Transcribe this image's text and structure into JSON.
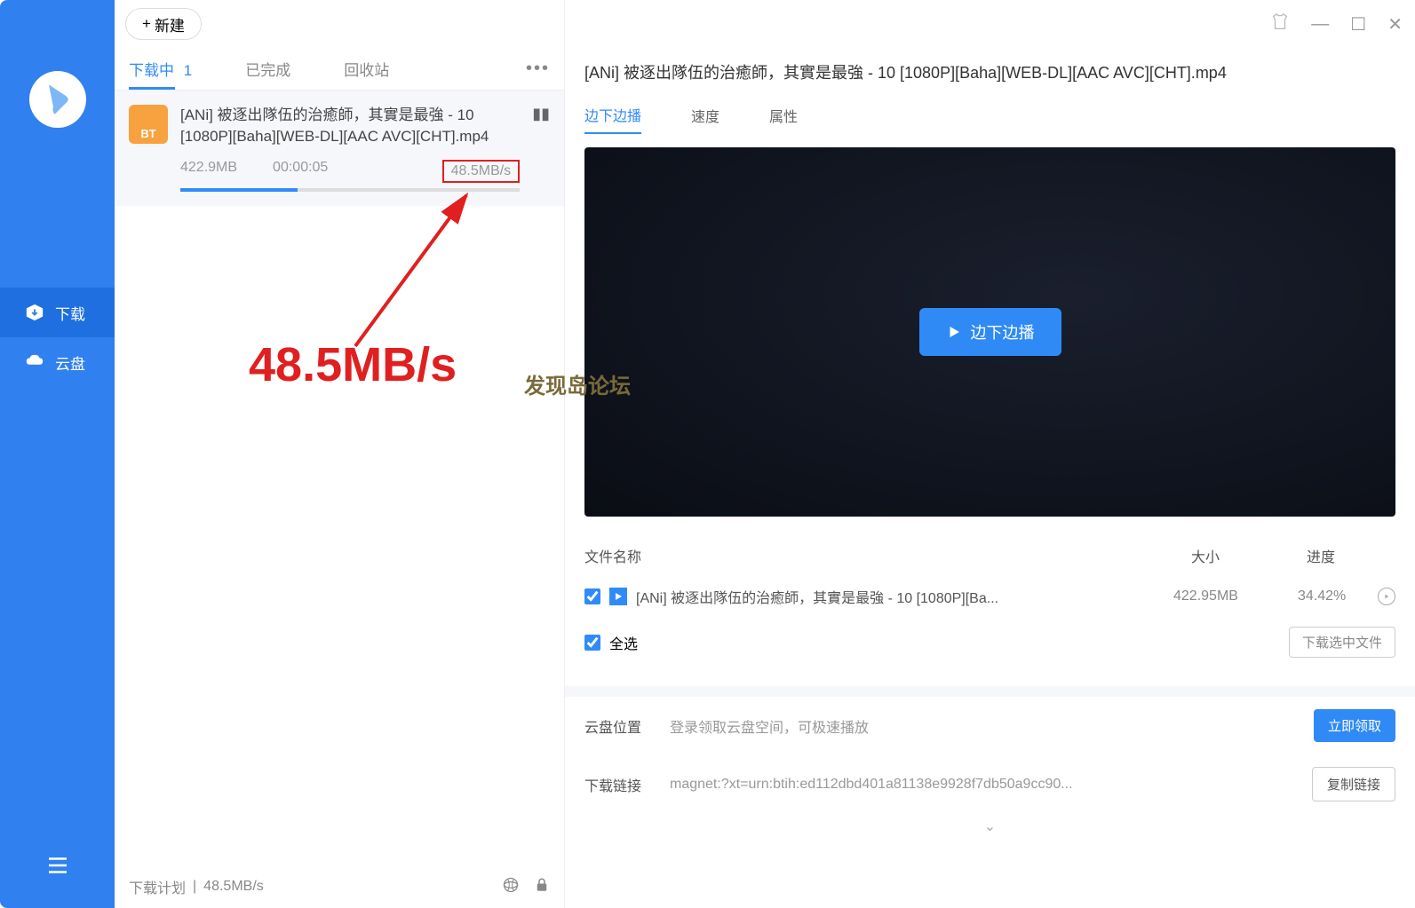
{
  "sidebar": {
    "items": [
      {
        "label": "下载"
      },
      {
        "label": "云盘"
      }
    ]
  },
  "topbar": {
    "new_label": "新建"
  },
  "tabs": {
    "downloading": "下载中",
    "downloading_count": "1",
    "completed": "已完成",
    "trash": "回收站"
  },
  "download": {
    "title": "[ANi] 被逐出隊伍的治癒師，其實是最強 - 10 [1080P][Baha][WEB-DL][AAC AVC][CHT].mp4",
    "size": "422.9MB",
    "elapsed": "00:00:05",
    "speed": "48.5MB/s"
  },
  "annotation": "48.5MB/s",
  "watermark": "发现岛论坛",
  "bottom": {
    "plan": "下载计划",
    "speed": "48.5MB/s"
  },
  "detail": {
    "title": "[ANi] 被逐出隊伍的治癒師，其實是最強 - 10 [1080P][Baha][WEB-DL][AAC AVC][CHT].mp4",
    "tabs": {
      "play": "边下边播",
      "speed": "速度",
      "props": "属性"
    },
    "play_button": "边下边播",
    "file_header": {
      "name": "文件名称",
      "size": "大小",
      "progress": "进度"
    },
    "file": {
      "name": "[ANi] 被逐出隊伍的治癒師，其實是最強 - 10 [1080P][Ba...",
      "size": "422.95MB",
      "progress": "34.42%"
    },
    "select_all": "全选",
    "download_selected": "下载选中文件",
    "cloud_label": "云盘位置",
    "cloud_hint": "登录领取云盘空间，可极速播放",
    "cloud_btn": "立即领取",
    "link_label": "下载链接",
    "link_val": "magnet:?xt=urn:btih:ed112dbd401a81138e9928f7db50a9cc90...",
    "copy_btn": "复制链接"
  }
}
